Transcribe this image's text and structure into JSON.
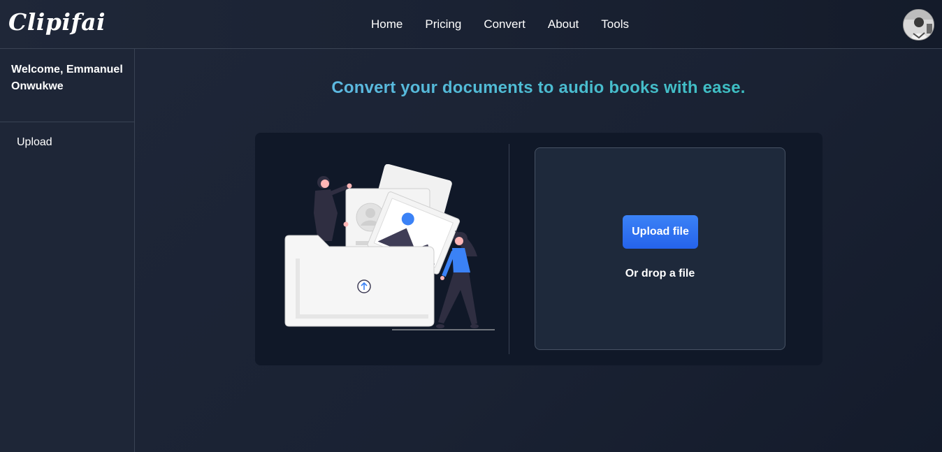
{
  "header": {
    "logo": "Clipifai",
    "nav": [
      "Home",
      "Pricing",
      "Convert",
      "About",
      "Tools"
    ]
  },
  "sidebar": {
    "welcome": "Welcome, Emmanuel Onwukwe",
    "items": [
      {
        "label": "Upload"
      }
    ]
  },
  "main": {
    "headline": "Convert your documents to audio books with ease.",
    "upload_button": "Upload file",
    "drop_text": "Or drop a file"
  },
  "icons": {
    "avatar": "user-avatar",
    "upload": "upload-arrow-icon",
    "illustration": "folder-upload-illustration"
  },
  "colors": {
    "background": "#1a2234",
    "card": "#101828",
    "dropzone": "#1e293b",
    "accent": "#3b82f6",
    "headline_start": "#6cb6f0",
    "headline_end": "#2ec2b4"
  }
}
